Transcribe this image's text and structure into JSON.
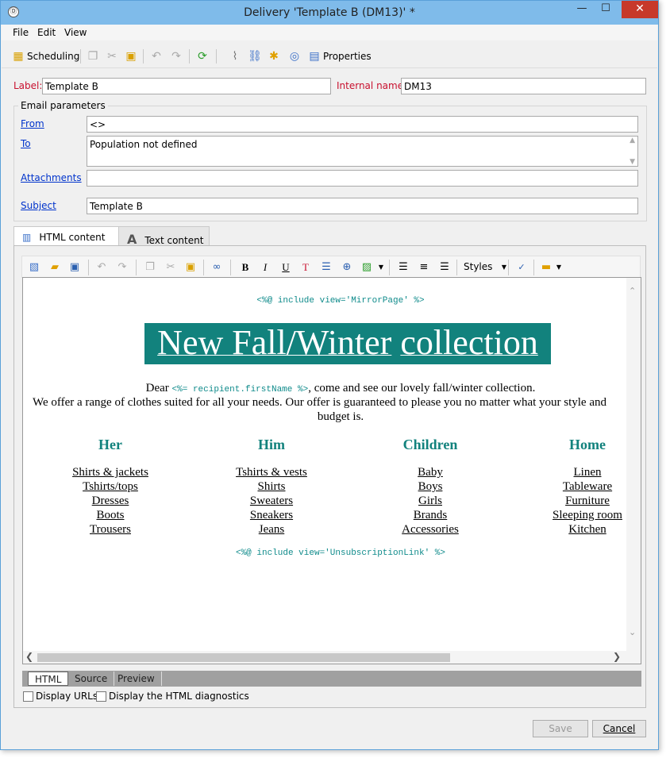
{
  "window": {
    "title": "Delivery 'Template B (DM13)' *",
    "app_icon": "Ⓓ"
  },
  "menu": [
    "File",
    "Edit",
    "View"
  ],
  "toolbar": {
    "scheduling": "Scheduling",
    "properties": "Properties"
  },
  "fields": {
    "label_caption": "Label:",
    "label_value": "Template B",
    "internal_caption": "Internal name:",
    "internal_value": "DM13"
  },
  "email": {
    "group_title": "Email parameters",
    "from_label": "From",
    "from_value": "<>",
    "to_label": "To",
    "to_value": "Population not defined",
    "attachments_label": "Attachments",
    "attachments_value": "",
    "subject_label": "Subject",
    "subject_value": "Template B"
  },
  "tabs": {
    "html": "HTML content",
    "text": "Text content"
  },
  "editor": {
    "styles": "Styles"
  },
  "content": {
    "include_top": "<%@ include view='MirrorPage' %>",
    "headline_1": "New Fall/Winter",
    "headline_2": "collection",
    "dear": "Dear ",
    "recipient": "<%= recipient.firstName %>",
    "dear_rest": ", come and see our lovely fall/winter collection.",
    "line2": "We offer a range of clothes suited for all your needs. Our offer is guaranteed to please you no matter what your style and",
    "line3": "budget is.",
    "columns": [
      {
        "title": "Her",
        "items": [
          "Shirts & jackets",
          "Tshirts/tops",
          "Dresses",
          "Boots",
          "Trousers"
        ]
      },
      {
        "title": "Him",
        "items": [
          "Tshirts & vests",
          "Shirts",
          "Sweaters",
          "Sneakers",
          "Jeans"
        ]
      },
      {
        "title": "Children",
        "items": [
          "Baby",
          "Boys",
          "Girls",
          "Brands",
          "Accessories"
        ]
      },
      {
        "title": "Home",
        "items": [
          "Linen",
          "Tableware",
          "Furniture",
          "Sleeping room",
          "Kitchen"
        ]
      }
    ],
    "include_bottom": "<%@ include view='UnsubscriptionLink' %>"
  },
  "modes": {
    "html": "HTML",
    "source": "Source",
    "preview": "Preview"
  },
  "options": {
    "display_urls": "Display URLs",
    "html_diag": "Display the HTML diagnostics"
  },
  "buttons": {
    "save": "Save",
    "cancel": "Cancel"
  }
}
